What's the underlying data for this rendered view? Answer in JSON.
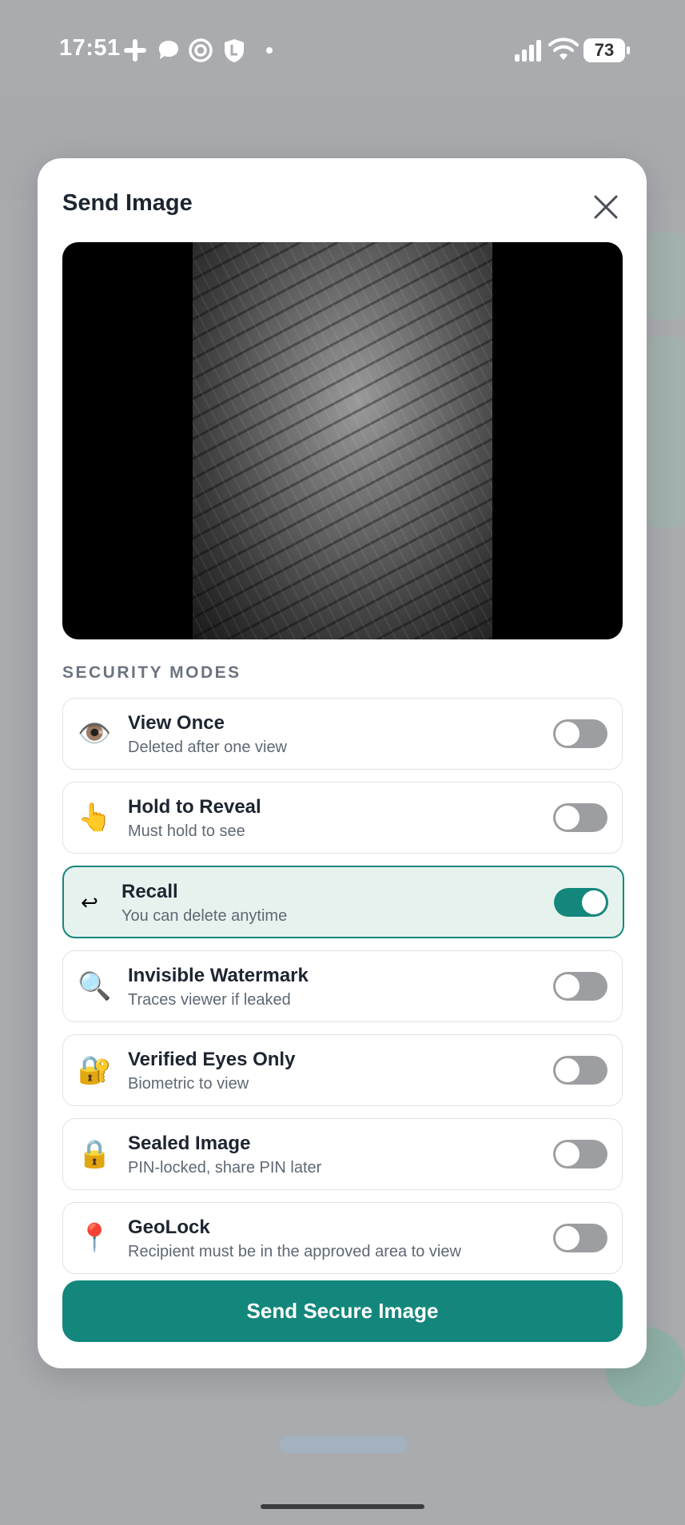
{
  "status_bar": {
    "time": "17:51",
    "battery": "73"
  },
  "modal": {
    "title": "Send Image",
    "section_label": "SECURITY MODES",
    "modes": [
      {
        "icon": "👁️",
        "icon_name": "eye-icon",
        "title": "View Once",
        "subtitle": "Deleted after one view",
        "enabled": false
      },
      {
        "icon": "👆",
        "icon_name": "pointing-hand-icon",
        "title": "Hold to Reveal",
        "subtitle": "Must hold to see",
        "enabled": false
      },
      {
        "icon": "↩",
        "icon_name": "recall-arrow-icon",
        "title": "Recall",
        "subtitle": "You can delete anytime",
        "enabled": true
      },
      {
        "icon": "🔍",
        "icon_name": "magnifier-icon",
        "title": "Invisible Watermark",
        "subtitle": "Traces viewer if leaked",
        "enabled": false
      },
      {
        "icon": "🔐",
        "icon_name": "lock-with-key-icon",
        "title": "Verified Eyes Only",
        "subtitle": "Biometric to view",
        "enabled": false
      },
      {
        "icon": "🔒",
        "icon_name": "lock-icon",
        "title": "Sealed Image",
        "subtitle": "PIN-locked, share PIN later",
        "enabled": false
      },
      {
        "icon": "📍",
        "icon_name": "location-pin-icon",
        "title": "GeoLock",
        "subtitle": "Recipient must be in the approved area to view",
        "enabled": false
      }
    ],
    "send_label": "Send Secure Image"
  },
  "colors": {
    "accent": "#14877c",
    "active_bg": "#e6f2ee",
    "toggle_off": "#9d9ea1"
  }
}
